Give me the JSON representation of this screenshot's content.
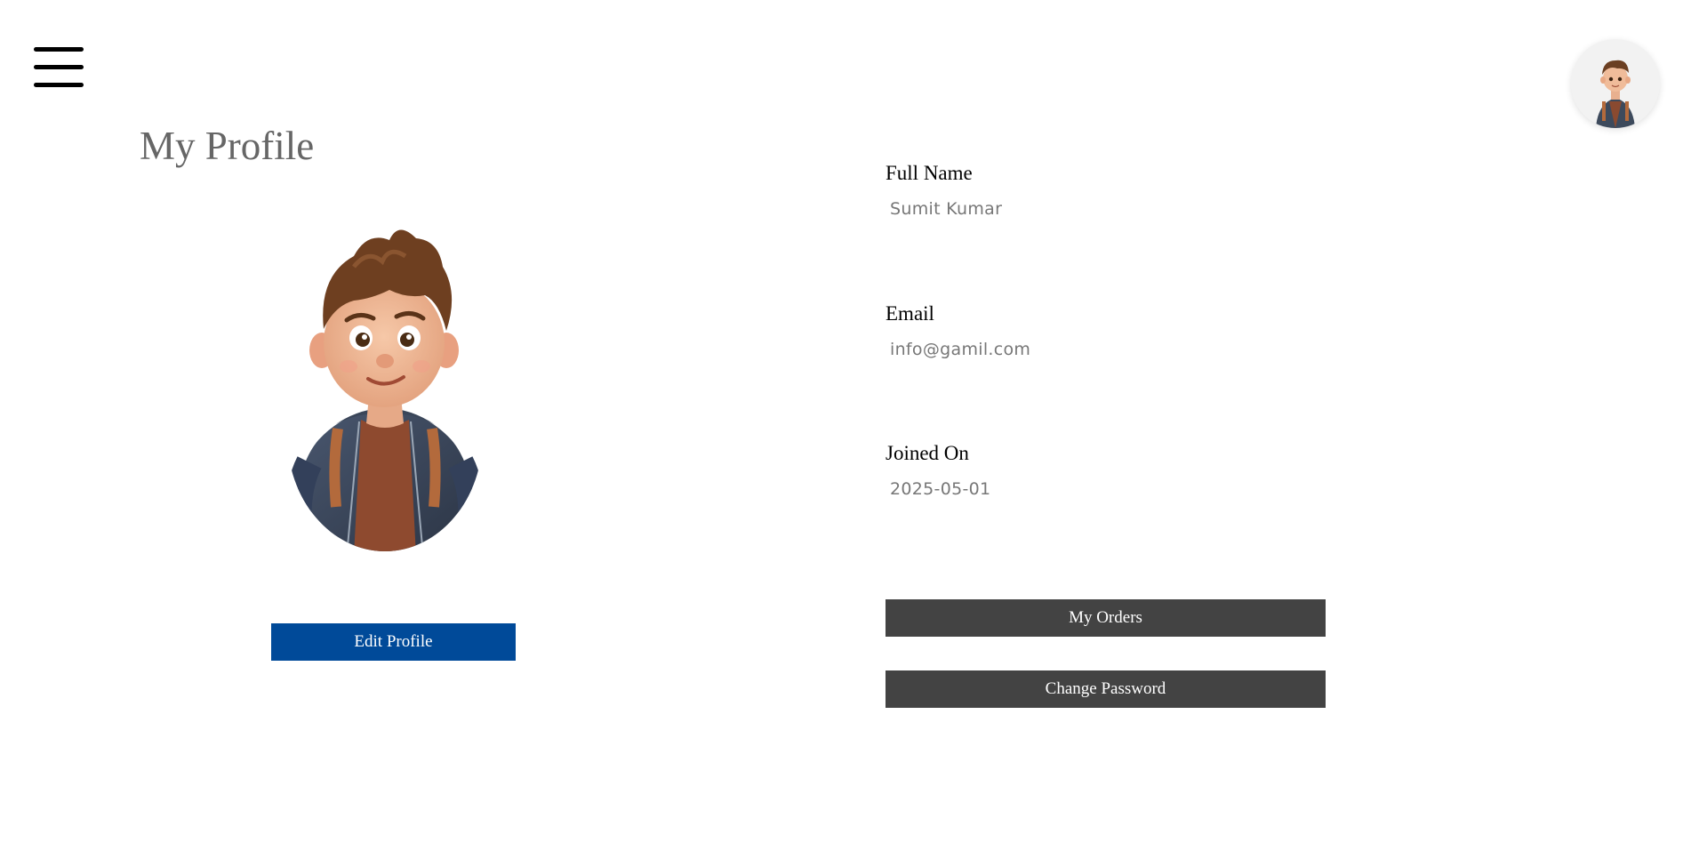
{
  "header": {
    "menu_icon": "hamburger-menu-icon",
    "avatar_icon": "user-avatar-icon"
  },
  "profile": {
    "title": "My Profile",
    "image": "cartoon-boy-avatar",
    "edit_label": "Edit Profile"
  },
  "fields": {
    "full_name_label": "Full Name",
    "full_name_value": "Sumit Kumar",
    "email_label": "Email",
    "email_value": "info@gamil.com",
    "joined_label": "Joined On",
    "joined_value": "2025-05-01"
  },
  "actions": {
    "orders_label": "My Orders",
    "password_label": "Change Password"
  },
  "colors": {
    "primary_button": "#004a99",
    "secondary_button": "#434343",
    "title_text": "#666666",
    "value_text": "#777777"
  }
}
